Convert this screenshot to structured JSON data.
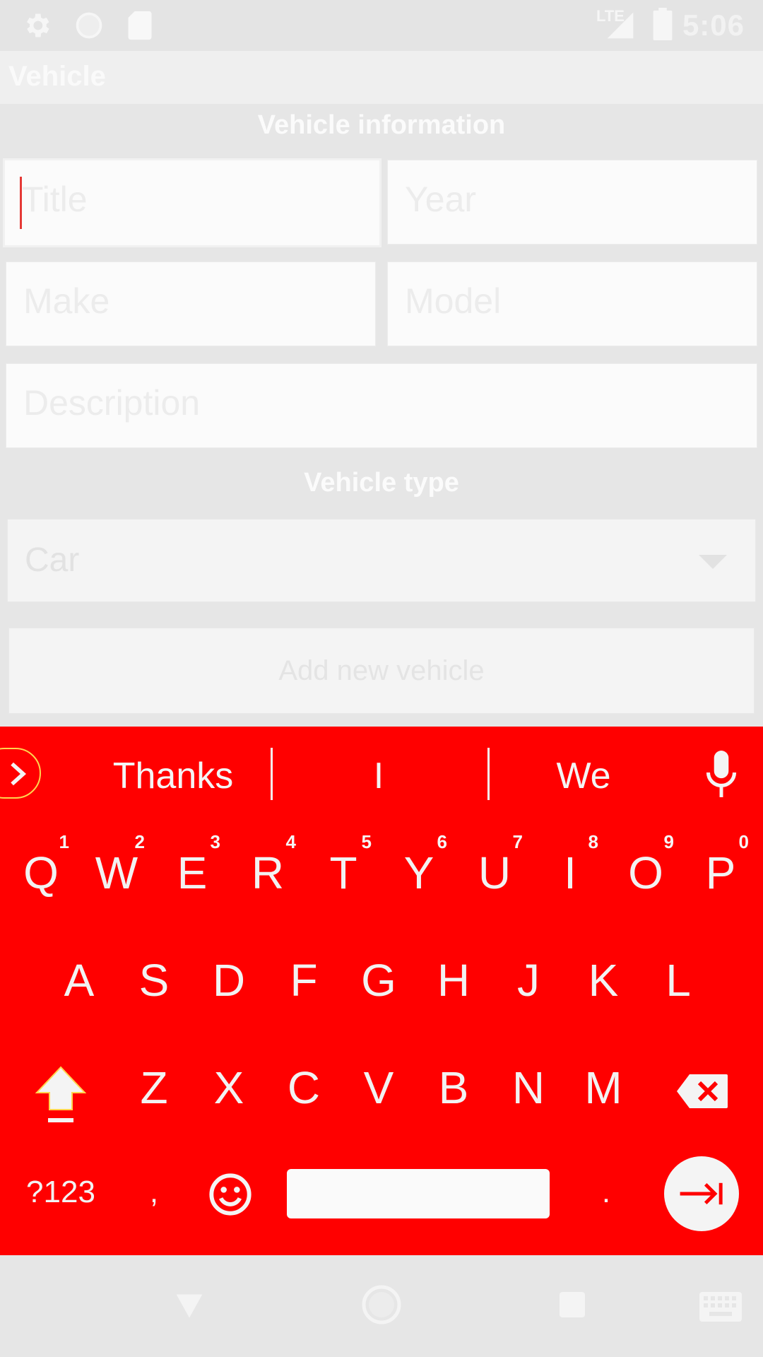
{
  "status_bar": {
    "time": "5:06",
    "network_label": "LTE",
    "icons": [
      "gear-icon",
      "circle-icon",
      "sd-card-icon",
      "signal-icon",
      "battery-icon"
    ]
  },
  "app_bar": {
    "title": "Vehicle"
  },
  "form": {
    "section_info": "Vehicle information",
    "title_placeholder": "Title",
    "year_placeholder": "Year",
    "make_placeholder": "Make",
    "model_placeholder": "Model",
    "description_placeholder": "Description",
    "section_type": "Vehicle type",
    "vehicle_type_value": "Car",
    "add_button_label": "Add new vehicle"
  },
  "keyboard": {
    "suggestions": [
      "Thanks",
      "I",
      "We"
    ],
    "row1": [
      {
        "key": "Q",
        "hint": "1"
      },
      {
        "key": "W",
        "hint": "2"
      },
      {
        "key": "E",
        "hint": "3"
      },
      {
        "key": "R",
        "hint": "4"
      },
      {
        "key": "T",
        "hint": "5"
      },
      {
        "key": "Y",
        "hint": "6"
      },
      {
        "key": "U",
        "hint": "7"
      },
      {
        "key": "I",
        "hint": "8"
      },
      {
        "key": "O",
        "hint": "9"
      },
      {
        "key": "P",
        "hint": "0"
      }
    ],
    "row2": [
      "A",
      "S",
      "D",
      "F",
      "G",
      "H",
      "J",
      "K",
      "L"
    ],
    "row3": [
      "Z",
      "X",
      "C",
      "V",
      "B",
      "N",
      "M"
    ],
    "symbols_label": "?123",
    "comma_label": ",",
    "period_label": ".",
    "colors": {
      "background": "#ff0000",
      "key_text": "#f2f2f2",
      "accent": "#ffd54f"
    }
  },
  "nav_bar": {
    "icons": [
      "back-icon",
      "home-icon",
      "recents-icon",
      "keyboard-icon"
    ]
  }
}
